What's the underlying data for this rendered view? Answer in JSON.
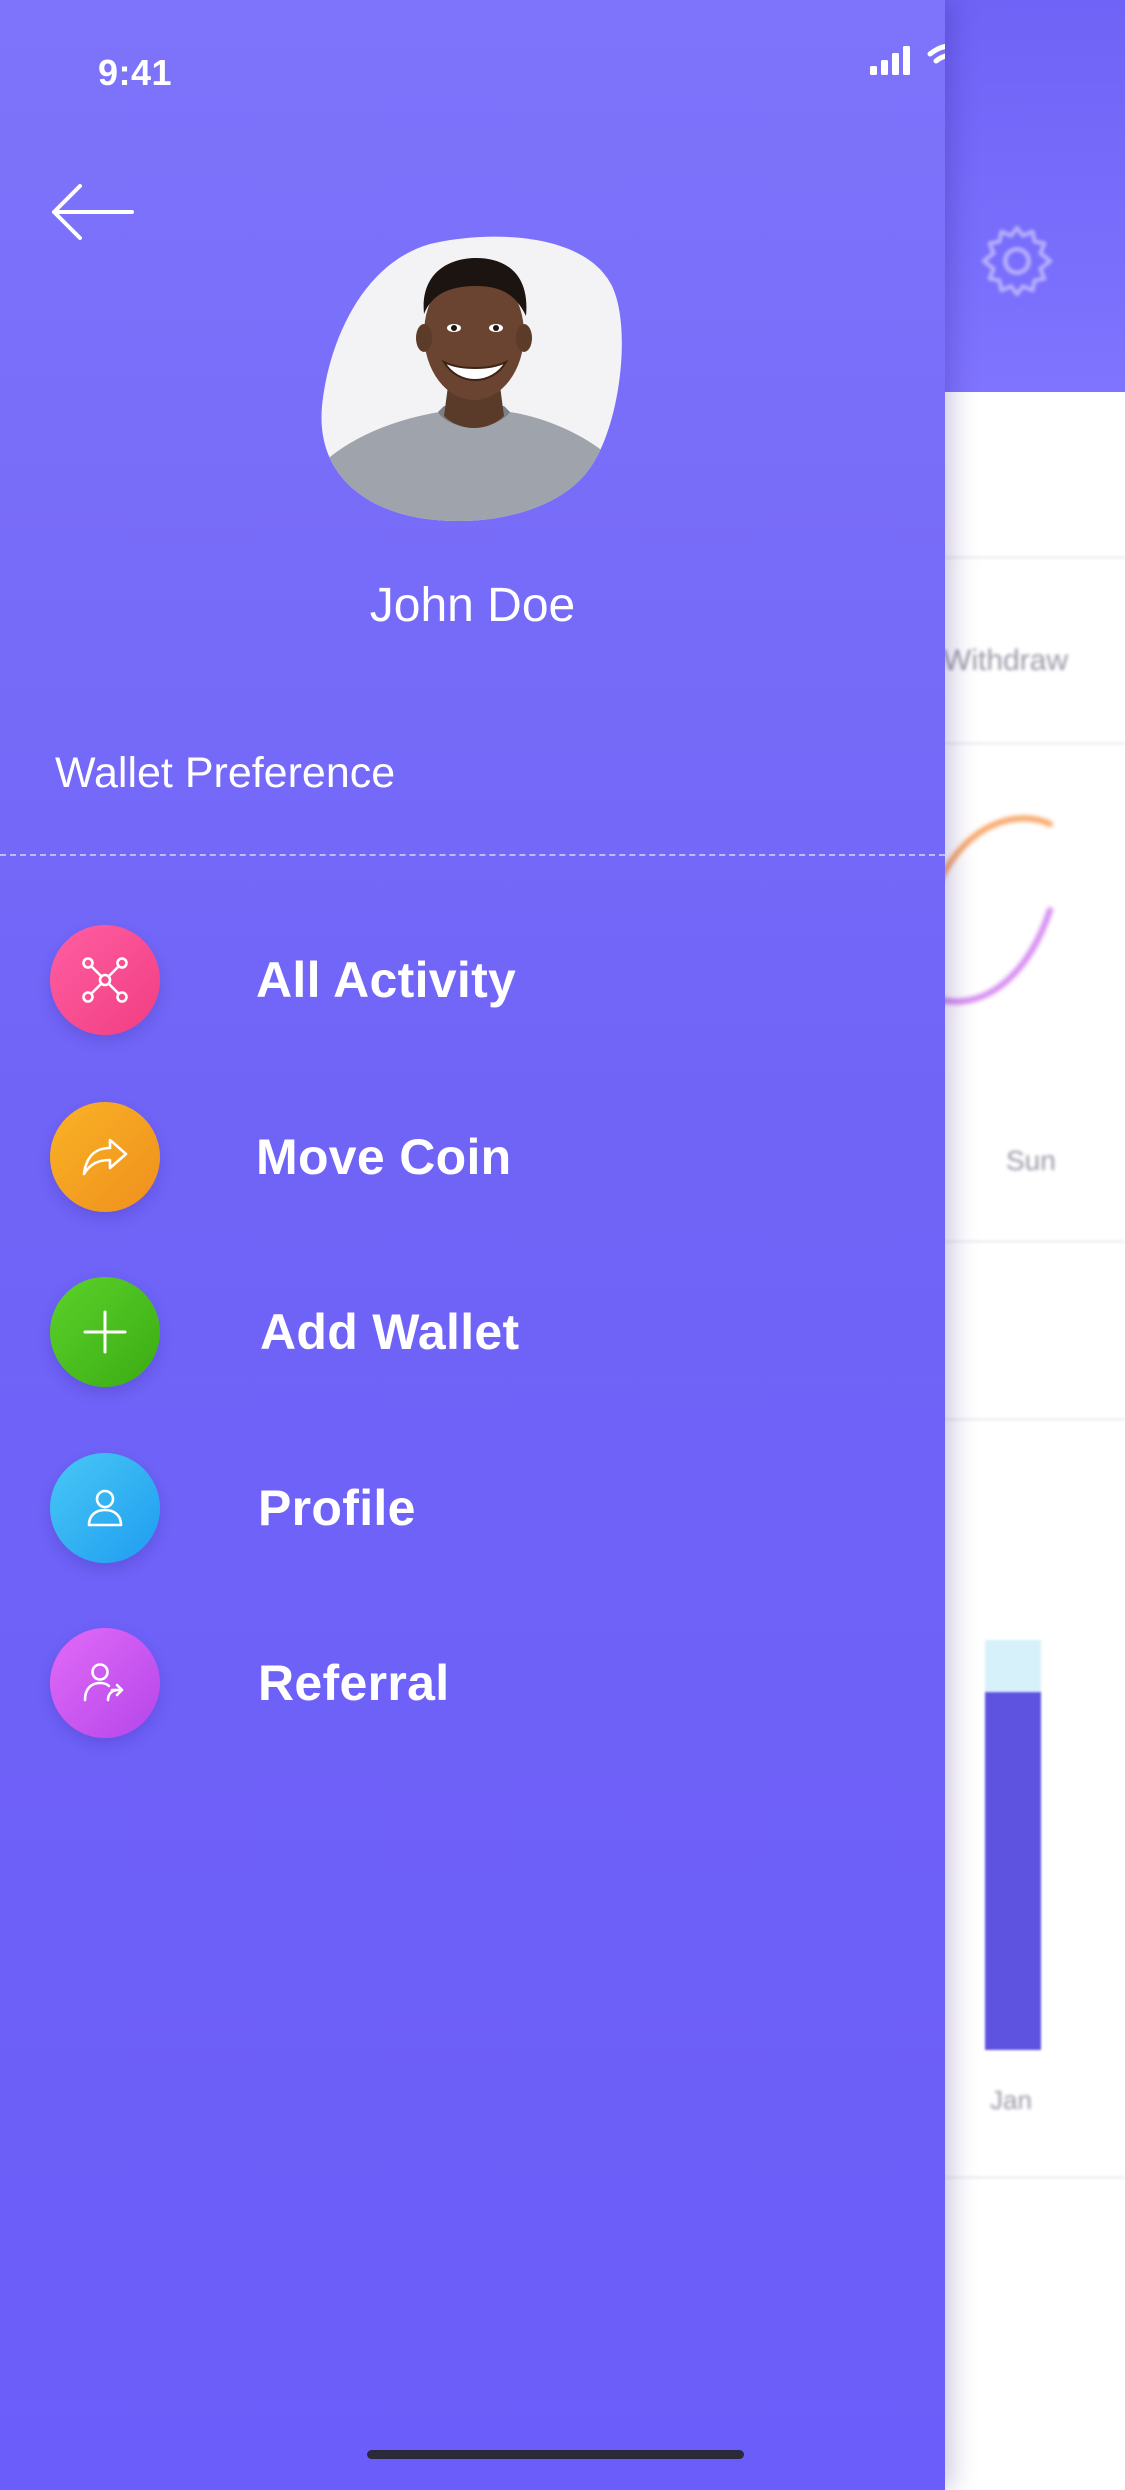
{
  "status_bar": {
    "time": "9:41"
  },
  "background": {
    "legend_withdraw": "Withdraw",
    "day_label": "Sun",
    "month_label": "Jan"
  },
  "drawer": {
    "user_name": "John Doe",
    "section_title": "Wallet Preference",
    "menu": [
      {
        "label": "All Activity",
        "icon": "network-icon",
        "color": "#f74a8e"
      },
      {
        "label": "Move Coin",
        "icon": "share-arrow-icon",
        "color": "#f4a023"
      },
      {
        "label": "Add Wallet",
        "icon": "plus-icon",
        "color": "#4cc11f"
      },
      {
        "label": "Profile",
        "icon": "user-icon",
        "color": "#33b4f3"
      },
      {
        "label": "Referral",
        "icon": "user-share-icon",
        "color": "#cc58f0"
      }
    ]
  },
  "colors": {
    "drawer_top": "#7e74fb",
    "drawer_bottom": "#6b5df9",
    "accent_bar": "#5e53e0"
  }
}
